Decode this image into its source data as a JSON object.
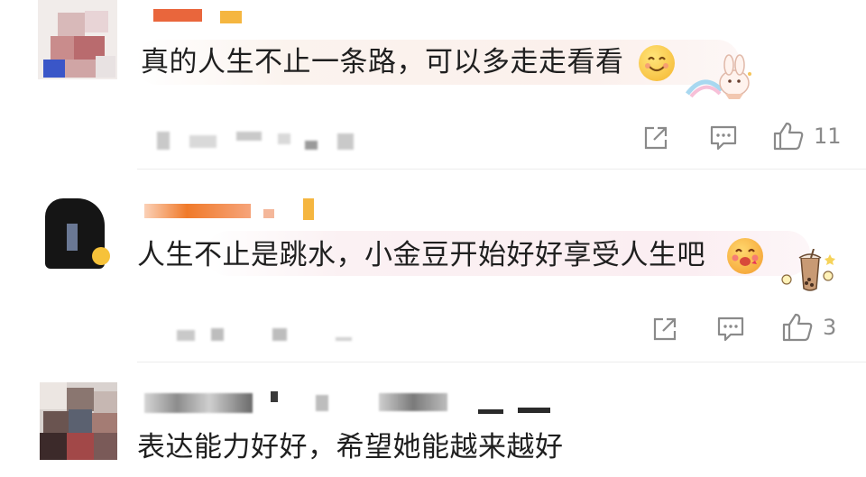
{
  "comments": [
    {
      "text": "真的人生不止一条路，可以多走走看看",
      "like_count": "11"
    },
    {
      "text": "人生不止是跳水，小金豆开始好好享受人生吧",
      "like_count": "3"
    },
    {
      "text": "表达能力好好，希望她能越来越好"
    }
  ],
  "icons": {
    "share": "share-icon",
    "reply": "comment-icon",
    "like": "thumbs-up-icon",
    "emoji1": "smiling-face-emoji",
    "emoji2": "face-blowing-kiss-emoji"
  },
  "colors": {
    "username_orange": "#f07a2a",
    "bubble_tint": "#fbf0ec",
    "icon_gray": "#8a8a8a"
  }
}
